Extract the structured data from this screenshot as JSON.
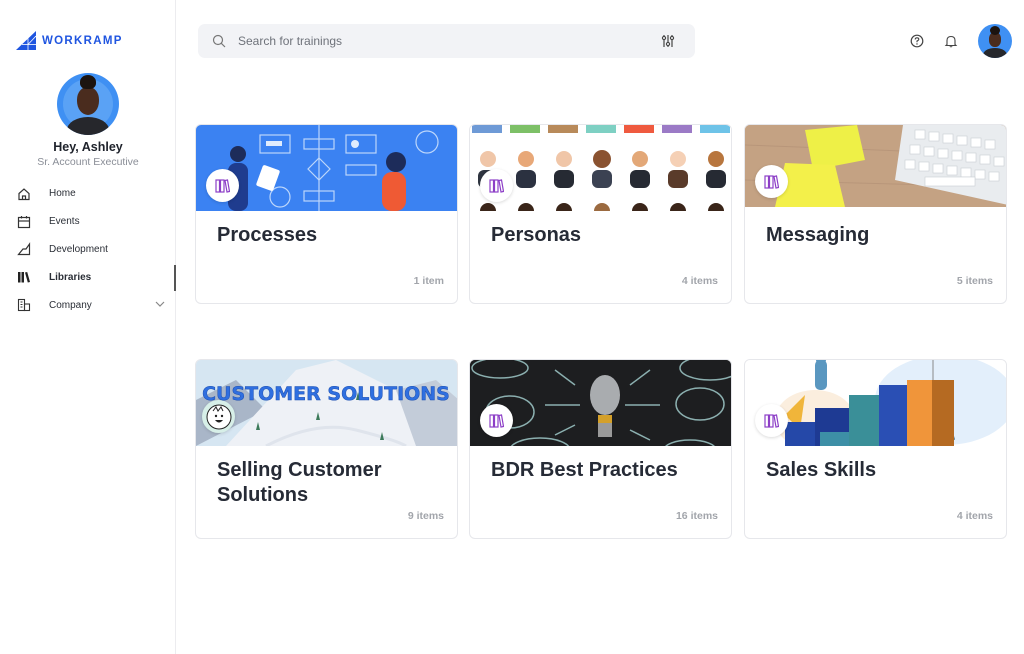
{
  "brand": {
    "name": "WORKRAMP",
    "accent": "#1f55e0"
  },
  "profile": {
    "greeting": "Hey, Ashley",
    "role": "Sr. Account Executive"
  },
  "sidebar": {
    "items": [
      {
        "label": "Home",
        "icon": "home-icon",
        "active": false
      },
      {
        "label": "Events",
        "icon": "calendar-icon",
        "active": false
      },
      {
        "label": "Development",
        "icon": "development-icon",
        "active": false
      },
      {
        "label": "Libraries",
        "icon": "libraries-icon",
        "active": true
      },
      {
        "label": "Company",
        "icon": "building-icon",
        "active": false,
        "expandable": true
      }
    ]
  },
  "search": {
    "placeholder": "Search for trainings",
    "value": ""
  },
  "header": {
    "icons": [
      "help-icon",
      "bell-icon",
      "user-avatar"
    ]
  },
  "libraries": [
    {
      "title": "Processes",
      "count": "1 item",
      "image": "process-flowchart-illustration",
      "badge": "library-icon"
    },
    {
      "title": "Personas",
      "count": "4 items",
      "image": "persona-avatars-illustration",
      "badge": "library-icon"
    },
    {
      "title": "Messaging",
      "count": "5 items",
      "image": "sticky-notes-keyboard-photo",
      "badge": "library-icon"
    },
    {
      "title": "Selling Customer Solutions",
      "count": "9 items",
      "image": "customer-solutions-mountain-banner",
      "image_text": "CUSTOMER SOLUTIONS",
      "badge": "custom-avatar"
    },
    {
      "title": "BDR Best Practices",
      "count": "16 items",
      "image": "lightbulb-chalkboard-photo",
      "badge": "library-icon"
    },
    {
      "title": "Sales Skills",
      "count": "4 items",
      "image": "growth-bars-illustration",
      "badge": "library-icon"
    }
  ]
}
